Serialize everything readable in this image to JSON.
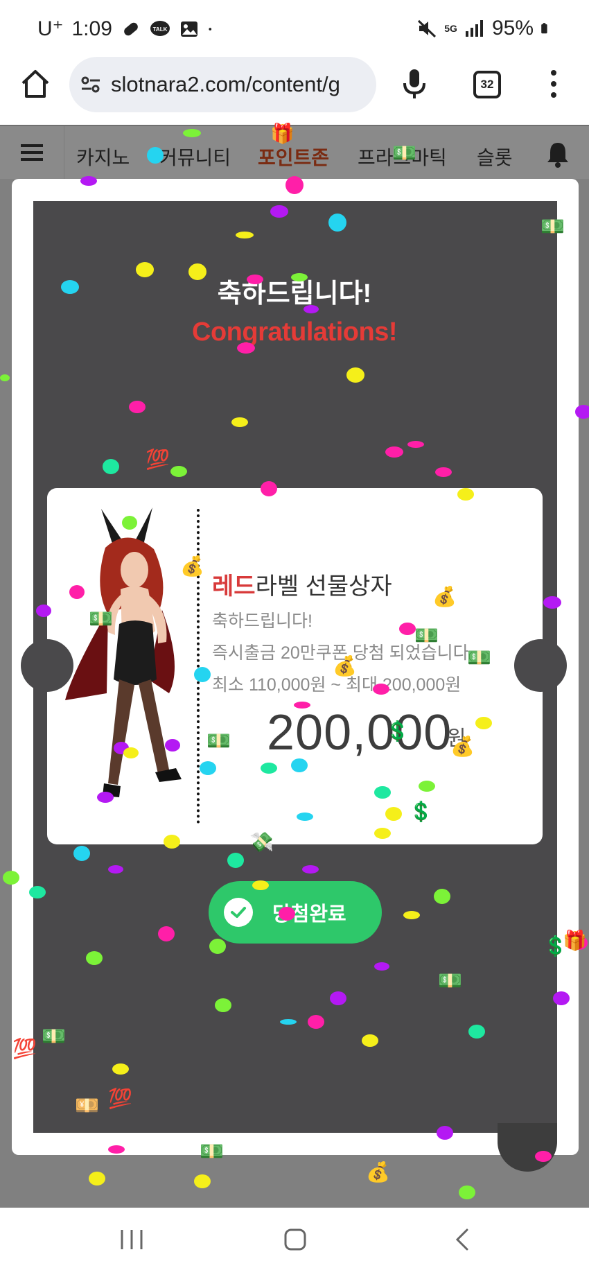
{
  "status_bar": {
    "carrier": "U⁺",
    "time": "1:09",
    "network": "5G",
    "battery": "95%"
  },
  "browser": {
    "url": "slotnara2.com/content/g",
    "tab_count": "32"
  },
  "site_nav": {
    "items": [
      {
        "label": "카지노"
      },
      {
        "label": "커뮤니티"
      },
      {
        "label": "포인트존"
      },
      {
        "label": "프라그마틱"
      },
      {
        "label": "슬롯"
      }
    ]
  },
  "modal": {
    "title_ko": "축하드립니다!",
    "title_en": "Congratulations!",
    "prize": {
      "name_highlight": "레드",
      "name_rest": "라벨 선물상자",
      "line1": "축하드립니다!",
      "line2": "즉시출금 20만쿠폰 당첨 되었습니다",
      "line3": "최소 110,000원 ~ 최대 200,000원",
      "amount": "200,000",
      "unit": "원"
    },
    "done_button": "당첨완료"
  },
  "colors": {
    "accent_red": "#e53b37",
    "button_green": "#2ec86a",
    "modal_dark": "#4a494b"
  }
}
